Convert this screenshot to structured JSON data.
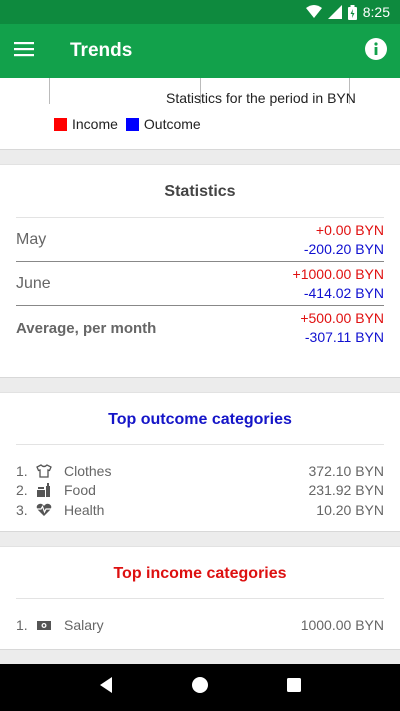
{
  "status": {
    "time": "8:25"
  },
  "appbar": {
    "title": "Trends"
  },
  "chart": {
    "caption": "Statistics for the period in BYN",
    "legend": [
      {
        "label": "Income",
        "color": "#ff0000"
      },
      {
        "label": "Outcome",
        "color": "#0000ff"
      }
    ]
  },
  "statistics": {
    "title": "Statistics",
    "rows": [
      {
        "label": "May",
        "income": "+0.00 BYN",
        "outcome": "-200.20 BYN"
      },
      {
        "label": "June",
        "income": "+1000.00 BYN",
        "outcome": "-414.02 BYN"
      },
      {
        "label": "Average, per month",
        "income": "+500.00 BYN",
        "outcome": "-307.11 BYN"
      }
    ]
  },
  "top_outcome": {
    "title": "Top outcome categories",
    "items": [
      {
        "num": "1.",
        "icon": "shirt-icon",
        "name": "Clothes",
        "amount": "372.10 BYN"
      },
      {
        "num": "2.",
        "icon": "food-icon",
        "name": "Food",
        "amount": "231.92 BYN"
      },
      {
        "num": "3.",
        "icon": "heart-pulse-icon",
        "name": "Health",
        "amount": "10.20 BYN"
      }
    ]
  },
  "top_income": {
    "title": "Top income categories",
    "items": [
      {
        "num": "1.",
        "icon": "banknote-icon",
        "name": "Salary",
        "amount": "1000.00 BYN"
      }
    ]
  },
  "colors": {
    "appbar": "#12a14b",
    "statusbar": "#0e8a3e",
    "income": "#e01010",
    "outcome": "#1010d0"
  }
}
